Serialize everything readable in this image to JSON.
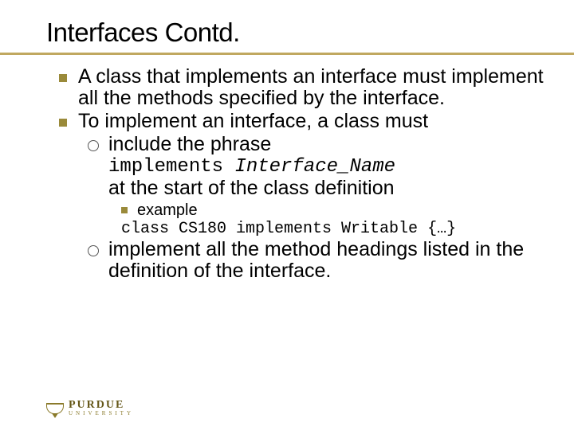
{
  "slide": {
    "title": "Interfaces Contd.",
    "bullet1": "A class that implements an interface must implement all the methods specified by the interface.",
    "bullet2": "To implement an interface, a class must",
    "sub1": "include the phrase",
    "code1_kw": "implements",
    "code1_it": "Interface_Name",
    "cont1": "at the start of the class definition",
    "ex_label": "example",
    "code2": "class CS180 implements Writable {…}",
    "sub2": "implement all the method headings listed in the definition of the interface."
  },
  "logo": {
    "line1": "PURDUE",
    "line2": "UNIVERSITY"
  }
}
